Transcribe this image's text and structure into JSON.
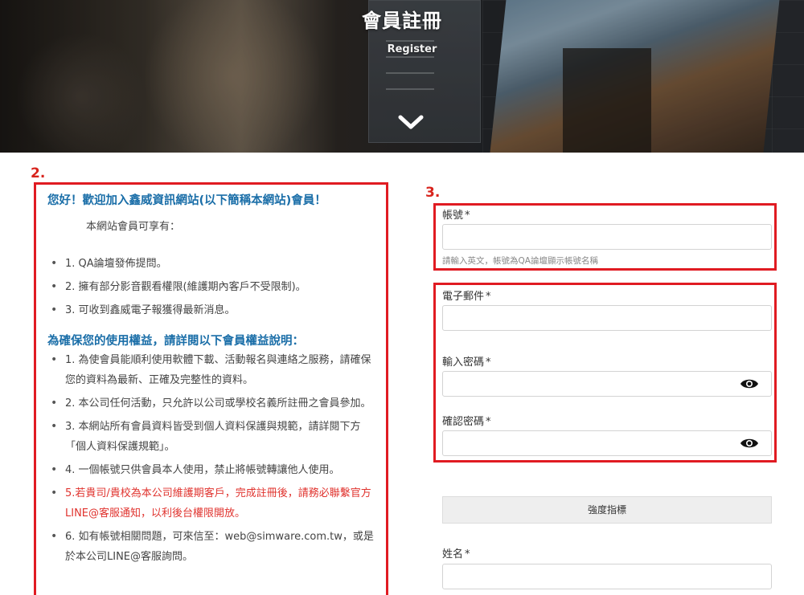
{
  "hero": {
    "title": "會員註冊",
    "subtitle": "Register",
    "chevron_icon": "chevron-down-icon"
  },
  "markers": {
    "step2": "2.",
    "step3": "3."
  },
  "info": {
    "welcome": "您好！歡迎加入鑫威資訊網站(以下簡稱本網站)會員！",
    "benefits_intro": "本網站會員可享有：",
    "benefits": [
      "1. QA論壇發佈提問。",
      "2. 擁有部分影音觀看權限(維護期內客戶不受限制)。",
      "3. 可收到鑫威電子報獲得最新消息。"
    ],
    "rules_title": "為確保您的使用權益，請詳閱以下會員權益說明：",
    "rules": [
      "1. 為使會員能順利使用軟體下載、活動報名與連絡之服務，請確保您的資料為最新、正確及完整性的資料。",
      "2. 本公司任何活動，只允許以公司或學校名義所註冊之會員參加。",
      "3. 本網站所有會員資料皆受到個人資料保護與規範，請詳閱下方「個人資料保護規範」。",
      "4. 一個帳號只供會員本人使用，禁止將帳號轉讓他人使用。",
      "5.若貴司/貴校為本公司維護期客戶，完成註冊後，請務必聯繫官方LINE@客服通知，以利後台權限開放。",
      "6. 如有帳號相關問題，可來信至：web@simware.com.tw，或是於本公司LINE@客服詢問。"
    ]
  },
  "form": {
    "account_label": "帳號",
    "account_value": "",
    "account_hint": "請輸入英文，帳號為QA論壇顯示帳號名稱",
    "email_label": "電子郵件",
    "email_value": "",
    "password_label": "輸入密碼",
    "password_value": "",
    "confirm_label": "確認密碼",
    "confirm_value": "",
    "required_mark": "*",
    "strength_label": "強度指標",
    "name_label": "姓名",
    "name_value": "",
    "eye_icon": "eye-icon"
  },
  "colors": {
    "accent_blue": "#1a6ea8",
    "highlight_red": "#e01b22",
    "warning_red": "#e0332e"
  }
}
